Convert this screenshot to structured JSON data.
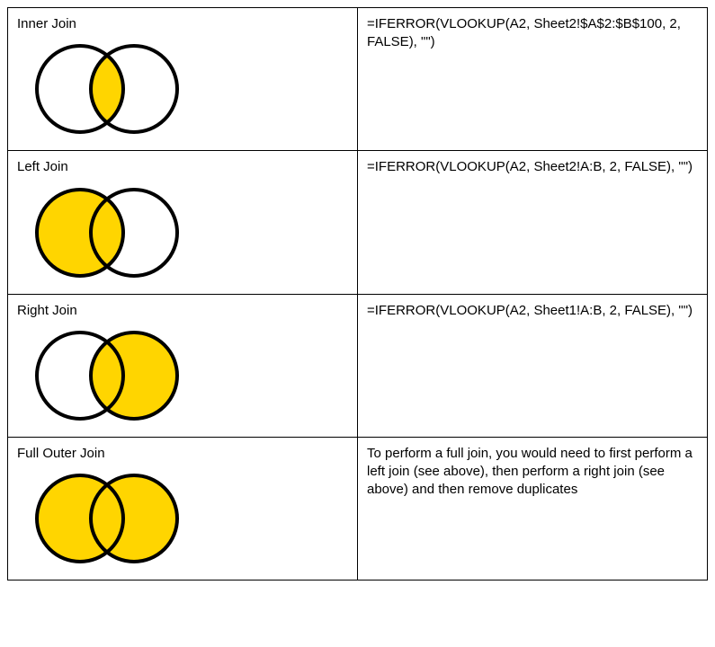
{
  "rows": [
    {
      "label": "Inner Join",
      "formula": "=IFERROR(VLOOKUP(A2, Sheet2!$A$2:$B$100, 2, FALSE), \"\")",
      "venn": "inner"
    },
    {
      "label": "Left Join",
      "formula": "=IFERROR(VLOOKUP(A2, Sheet2!A:B, 2, FALSE), \"\")",
      "venn": "left"
    },
    {
      "label": "Right Join",
      "formula": "=IFERROR(VLOOKUP(A2, Sheet1!A:B, 2, FALSE), \"\")",
      "venn": "right"
    },
    {
      "label": "Full Outer Join",
      "formula": "To perform a full join, you would need to first perform a left join (see above), then perform a right join (see above) and then remove duplicates",
      "venn": "full"
    }
  ],
  "colors": {
    "fill": "#FFD500",
    "stroke": "#000000"
  }
}
